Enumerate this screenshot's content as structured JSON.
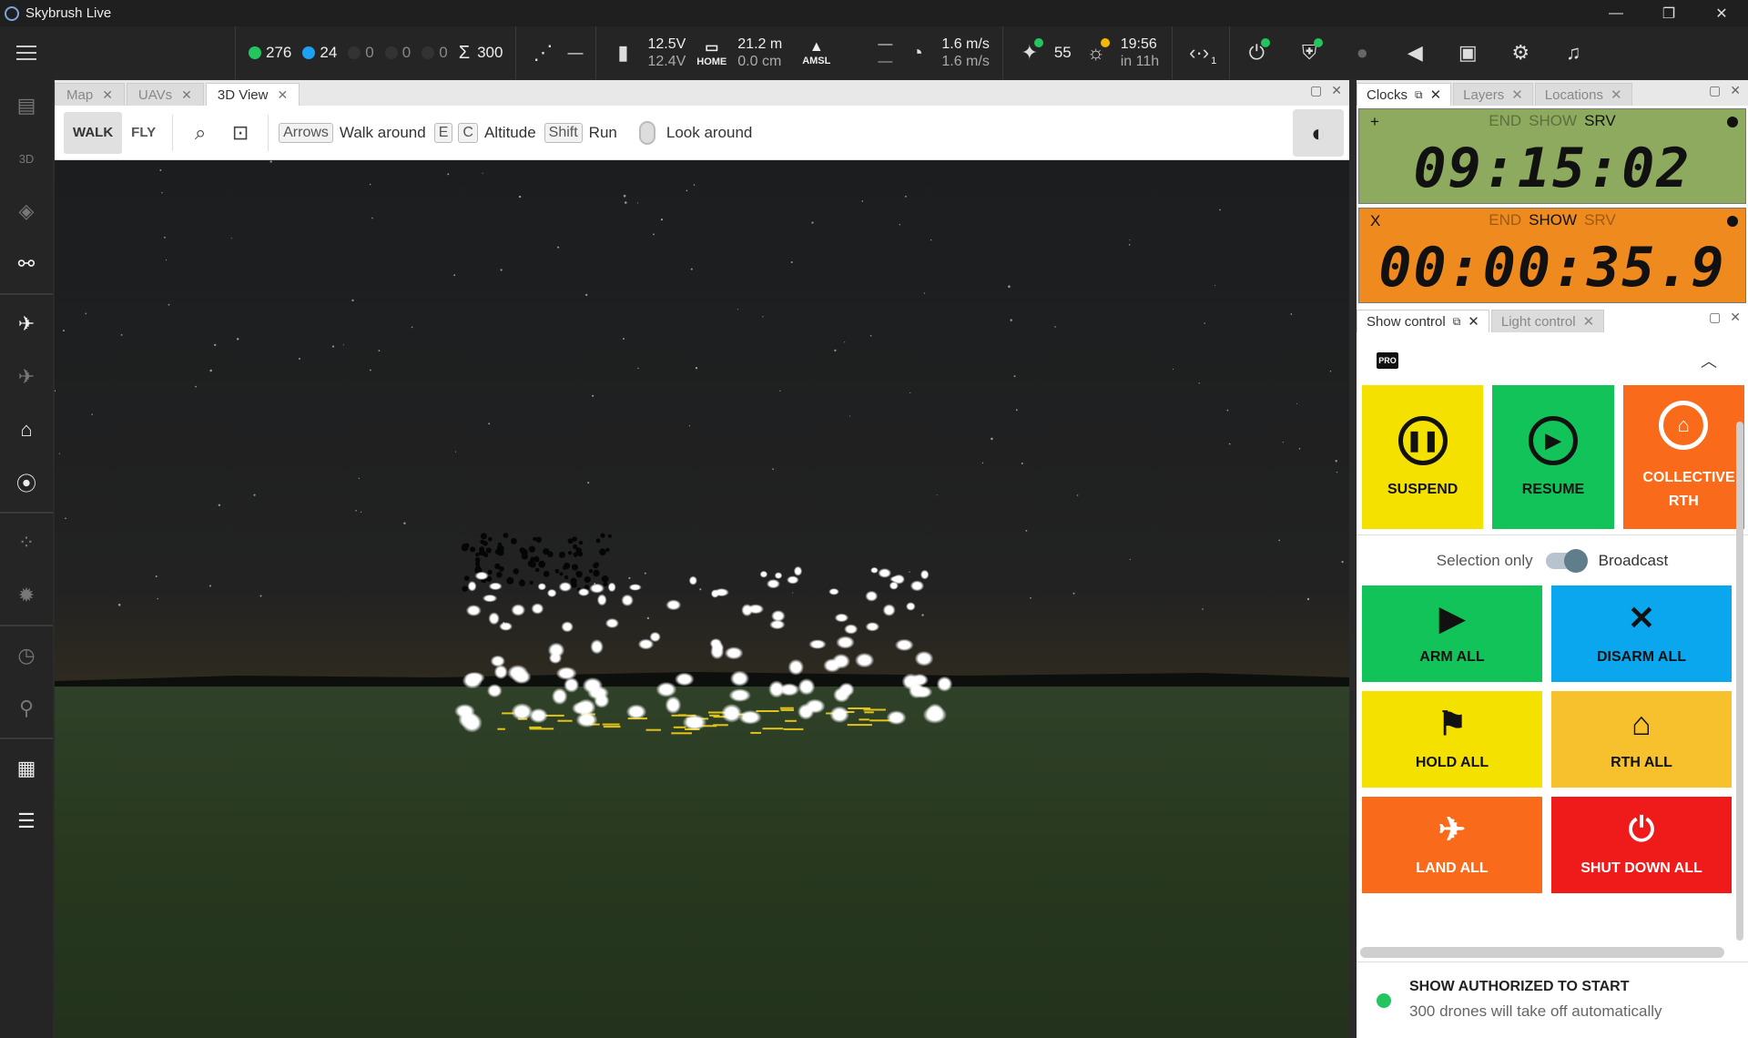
{
  "app": {
    "title": "Skybrush Live"
  },
  "window_controls": {
    "minimize": "—",
    "maximize": "❐",
    "close": "✕"
  },
  "header": {
    "status_counts": [
      {
        "value": "276",
        "color": "#22c55e"
      },
      {
        "value": "24",
        "color": "#1da1f2"
      },
      {
        "value": "0",
        "color": "#333333"
      },
      {
        "value": "0",
        "color": "#333333"
      },
      {
        "value": "0",
        "color": "#333333"
      }
    ],
    "total": "300",
    "formation_value": "—",
    "battery": {
      "main": "12.5V",
      "sub": "12.4V"
    },
    "home": {
      "label": "HOME",
      "main": "21.2 m",
      "sub": "0.0 cm"
    },
    "amsl": {
      "label": "AMSL",
      "main": "—",
      "sub": "—"
    },
    "speed": {
      "main": "1.6 m/s",
      "sub": "1.6 m/s"
    },
    "gps_count": "55",
    "sunset": {
      "main": "19:56",
      "sub": "in 11h"
    },
    "link_sub": "1"
  },
  "main_tabs": [
    {
      "label": "Map",
      "active": false
    },
    {
      "label": "UAVs",
      "active": false
    },
    {
      "label": "3D View",
      "active": true
    }
  ],
  "viewtools": {
    "walk": "WALK",
    "fly": "FLY",
    "keys": {
      "arrows": "Arrows",
      "walk_around": "Walk around",
      "e": "E",
      "c": "C",
      "altitude": "Altitude",
      "shift": "Shift",
      "run": "Run",
      "look_around": "Look around"
    }
  },
  "right_tabs_top": [
    {
      "label": "Clocks",
      "active": true
    },
    {
      "label": "Layers",
      "active": false
    },
    {
      "label": "Locations",
      "active": false
    }
  ],
  "clocks": [
    {
      "symbol": "+",
      "labels": [
        "END",
        "SHOW",
        "SRV"
      ],
      "active": "SRV",
      "time": "09:15:02",
      "color": "#8eaa5e"
    },
    {
      "symbol": "X",
      "labels": [
        "END",
        "SHOW",
        "SRV"
      ],
      "active": "SHOW",
      "time": "00:00:35.9",
      "color": "#ee8a1e"
    }
  ],
  "right_tabs_bottom": [
    {
      "label": "Show control",
      "active": true
    },
    {
      "label": "Light control",
      "active": false
    }
  ],
  "show_control": {
    "pro_badge": "PRO",
    "big_buttons": [
      {
        "label": "SUSPEND",
        "color": "#f5e100",
        "icon": "pause-icon"
      },
      {
        "label": "RESUME",
        "color": "#12c35a",
        "icon": "play-icon"
      },
      {
        "label": "COLLECTIVE RTH",
        "color": "#f96a1b",
        "icon": "home-icon"
      }
    ],
    "selection_only": "Selection only",
    "broadcast": "Broadcast",
    "grid_buttons": [
      {
        "label": "ARM ALL",
        "color": "#12c35a",
        "text_color": "#111111",
        "icon": "play-icon"
      },
      {
        "label": "DISARM ALL",
        "color": "#0aa7ee",
        "text_color": "#111111",
        "icon": "close-icon"
      },
      {
        "label": "HOLD ALL",
        "color": "#f5e100",
        "text_color": "#111111",
        "icon": "flag-icon"
      },
      {
        "label": "RTH ALL",
        "color": "#f6c12d",
        "text_color": "#111111",
        "icon": "home-icon"
      },
      {
        "label": "LAND ALL",
        "color": "#f96a1b",
        "text_color": "#ffffff",
        "icon": "landing-icon"
      },
      {
        "label": "SHUT DOWN ALL",
        "color": "#ef1a1a",
        "text_color": "#ffffff",
        "icon": "power-icon"
      }
    ],
    "auth_title": "SHOW AUTHORIZED TO START",
    "auth_sub": "300 drones will take off automatically"
  }
}
